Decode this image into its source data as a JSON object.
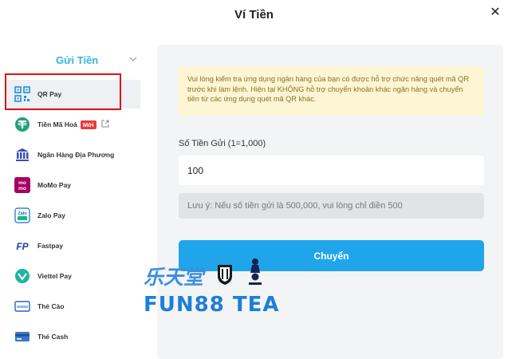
{
  "header": {
    "title": "Ví Tiền",
    "close_glyph": "✕"
  },
  "sidebar": {
    "section_title": "Gửi Tiền",
    "items": [
      {
        "label": "QR Pay",
        "icon": "qr-code-icon",
        "active": true
      },
      {
        "label": "Tiền Mã Hoá",
        "icon": "tether-icon",
        "badge": "Mới",
        "external": true
      },
      {
        "label": "Ngân Hàng Địa Phương",
        "icon": "bank-icon"
      },
      {
        "label": "MoMo Pay",
        "icon": "momo-icon"
      },
      {
        "label": "Zalo Pay",
        "icon": "zalopay-icon"
      },
      {
        "label": "Fastpay",
        "icon": "fastpay-icon"
      },
      {
        "label": "Viettel Pay",
        "icon": "viettelpay-icon"
      },
      {
        "label": "Thẻ Cào",
        "icon": "scratch-card-icon"
      },
      {
        "label": "Thẻ Cash",
        "icon": "cash-card-icon"
      }
    ]
  },
  "main": {
    "notice": "Vui lòng kiểm tra ứng dụng ngân hàng của bạn có được hỗ trợ chức năng quét mã QR trước khi làm lệnh. Hiện tại KHÔNG hỗ trợ chuyển khoản khác ngân hàng và chuyển tiền từ các ứng dụng quét mã QR khác.",
    "amount_label": "Số Tiền Gửi (1=1,000)",
    "amount_value": "100",
    "note": "Lưu ý: Nếu số tiền gửi là 500,000, vui lòng chỉ điền 500",
    "submit_label": "Chuyển"
  },
  "watermark": {
    "cn": "乐天堂",
    "en": "FUN88 TEA"
  },
  "colors": {
    "accent": "#21a5ea",
    "section_title": "#36b5e3",
    "notice_bg": "#fdf6d4",
    "notice_text": "#8b7027",
    "badge": "#e83a3a",
    "highlight": "#e01010"
  }
}
